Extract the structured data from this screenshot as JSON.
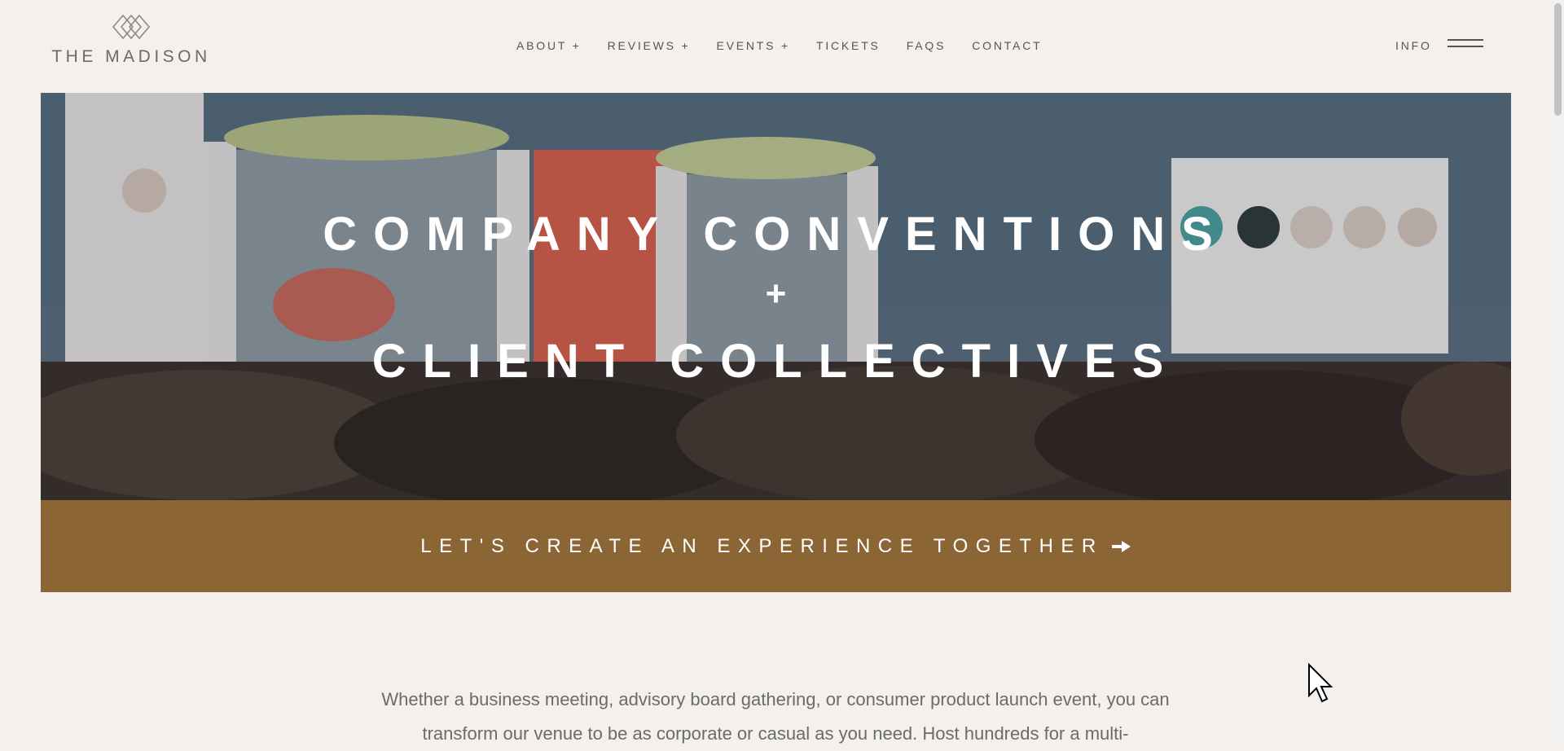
{
  "header": {
    "logo_text": "THE MADISON",
    "nav": [
      {
        "label": "ABOUT +"
      },
      {
        "label": "REVIEWS +"
      },
      {
        "label": "EVENTS +"
      },
      {
        "label": "TICKETS"
      },
      {
        "label": "FAQS"
      },
      {
        "label": "CONTACT"
      }
    ],
    "info_label": "INFO",
    "menu_icon": "hamburger-icon"
  },
  "hero": {
    "title_line1": "COMPANY CONVENTIONS",
    "title_line2": "+",
    "title_line3": "CLIENT COLLECTIVES"
  },
  "cta": {
    "label": "LET'S CREATE AN EXPERIENCE TOGETHER",
    "icon": "arrow-right-icon",
    "color": "#8c6535"
  },
  "body": {
    "text": "Whether a business meeting, advisory board gathering, or consumer product launch event, you can transform our venue to be as corporate or casual as you need. Host hundreds for a multi-"
  },
  "colors": {
    "background": "#f3f0ed",
    "nav_text": "#555555",
    "hero_text": "#ffffff"
  }
}
